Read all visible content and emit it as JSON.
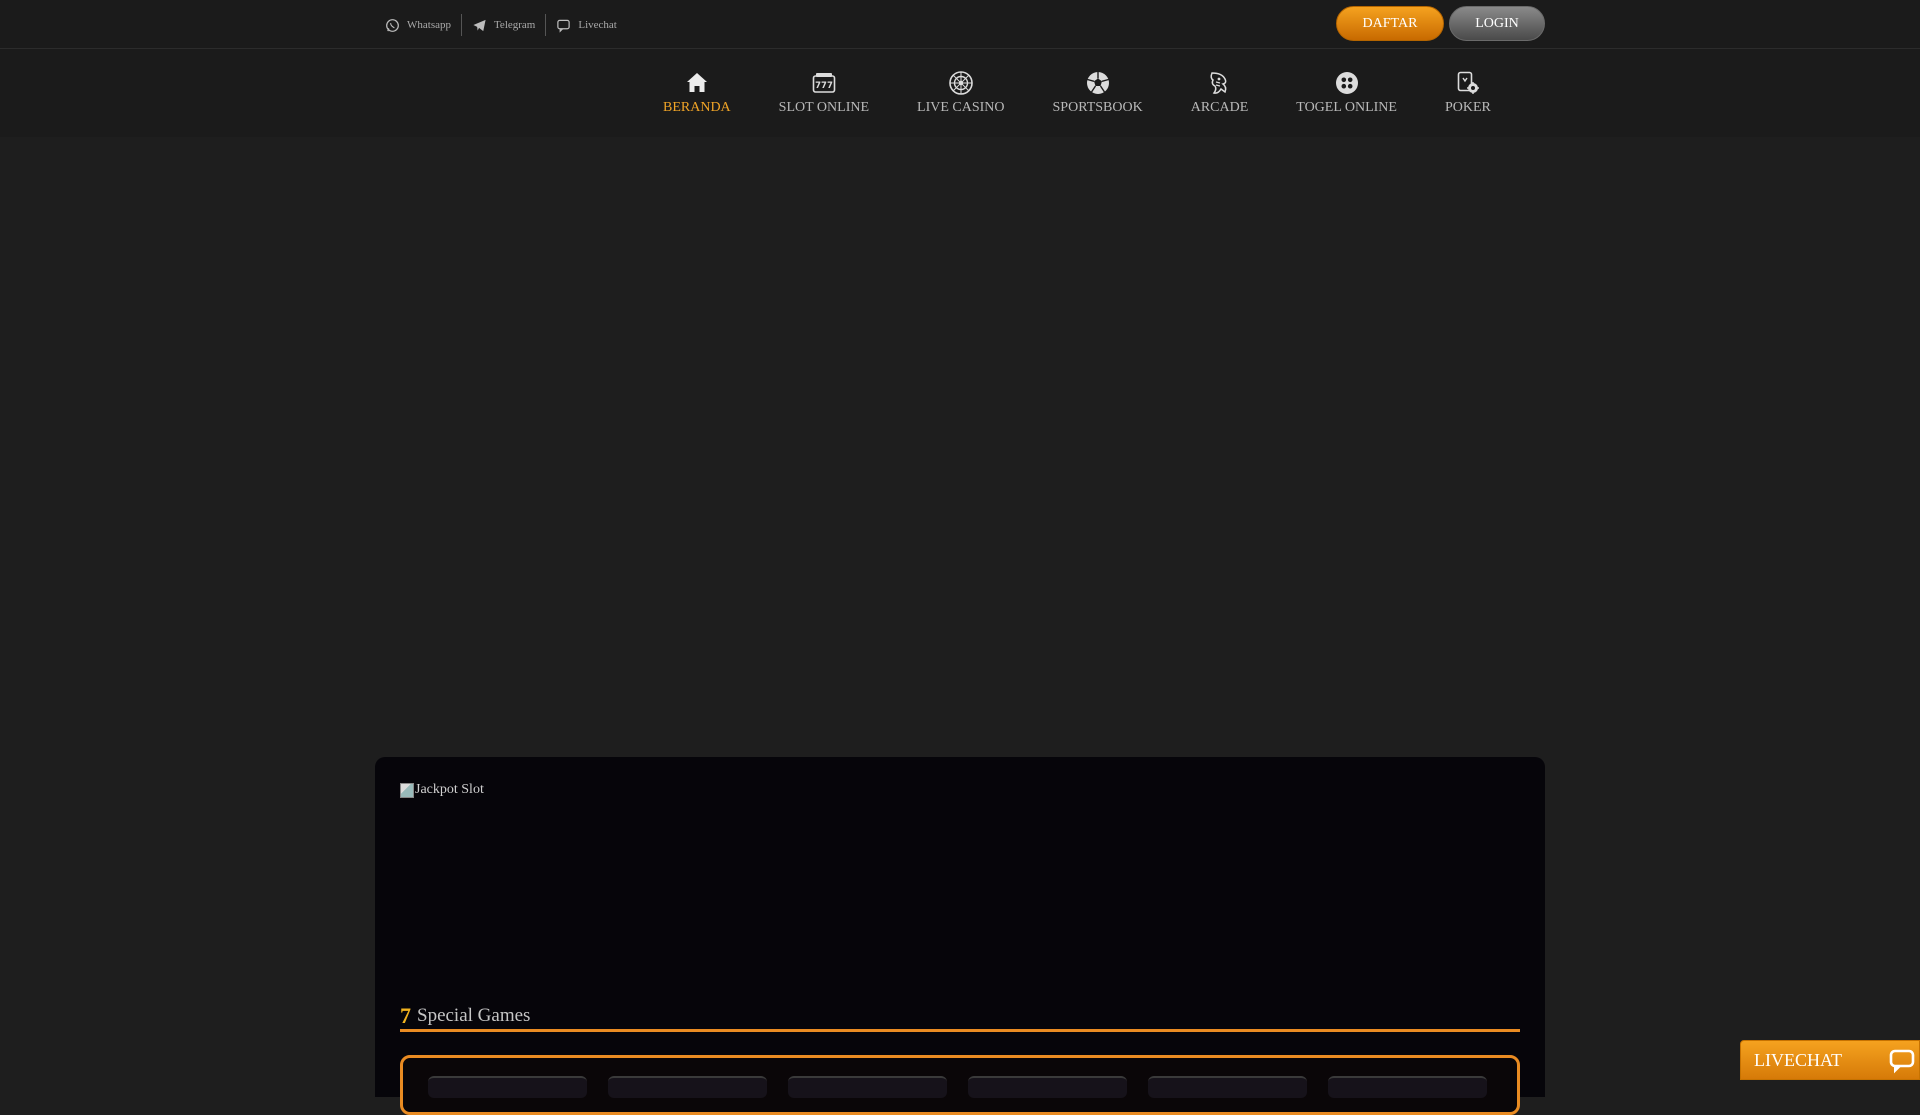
{
  "topbar": {
    "contacts": [
      {
        "label": "Whatsapp",
        "icon": "whatsapp-icon"
      },
      {
        "label": "Telegram",
        "icon": "telegram-icon"
      },
      {
        "label": "Livechat",
        "icon": "chat-bubble-icon"
      }
    ],
    "daftar_label": "DAFTAR",
    "login_label": "LOGIN"
  },
  "nav": {
    "items": [
      {
        "label": "BERANDA",
        "icon": "home-icon",
        "active": true
      },
      {
        "label": "SLOT ONLINE",
        "icon": "slot-machine-icon"
      },
      {
        "label": "LIVE CASINO",
        "icon": "roulette-icon"
      },
      {
        "label": "SPORTSBOOK",
        "icon": "soccer-ball-icon"
      },
      {
        "label": "ARCADE",
        "icon": "fish-icon"
      },
      {
        "label": "TOGEL ONLINE",
        "icon": "lottery-ball-icon"
      },
      {
        "label": "POKER",
        "icon": "poker-card-icon"
      }
    ]
  },
  "jackpot": {
    "alt_text": "Jackpot Slot"
  },
  "special_games": {
    "glyph": "7",
    "title": "Special Games"
  },
  "livechat": {
    "label": "LIVECHAT",
    "icon": "chat-bubble-icon"
  },
  "colors": {
    "accent": "#f0a427",
    "background": "#1e1e1e",
    "panel": "#06050a",
    "header": "#1b1b1b"
  }
}
